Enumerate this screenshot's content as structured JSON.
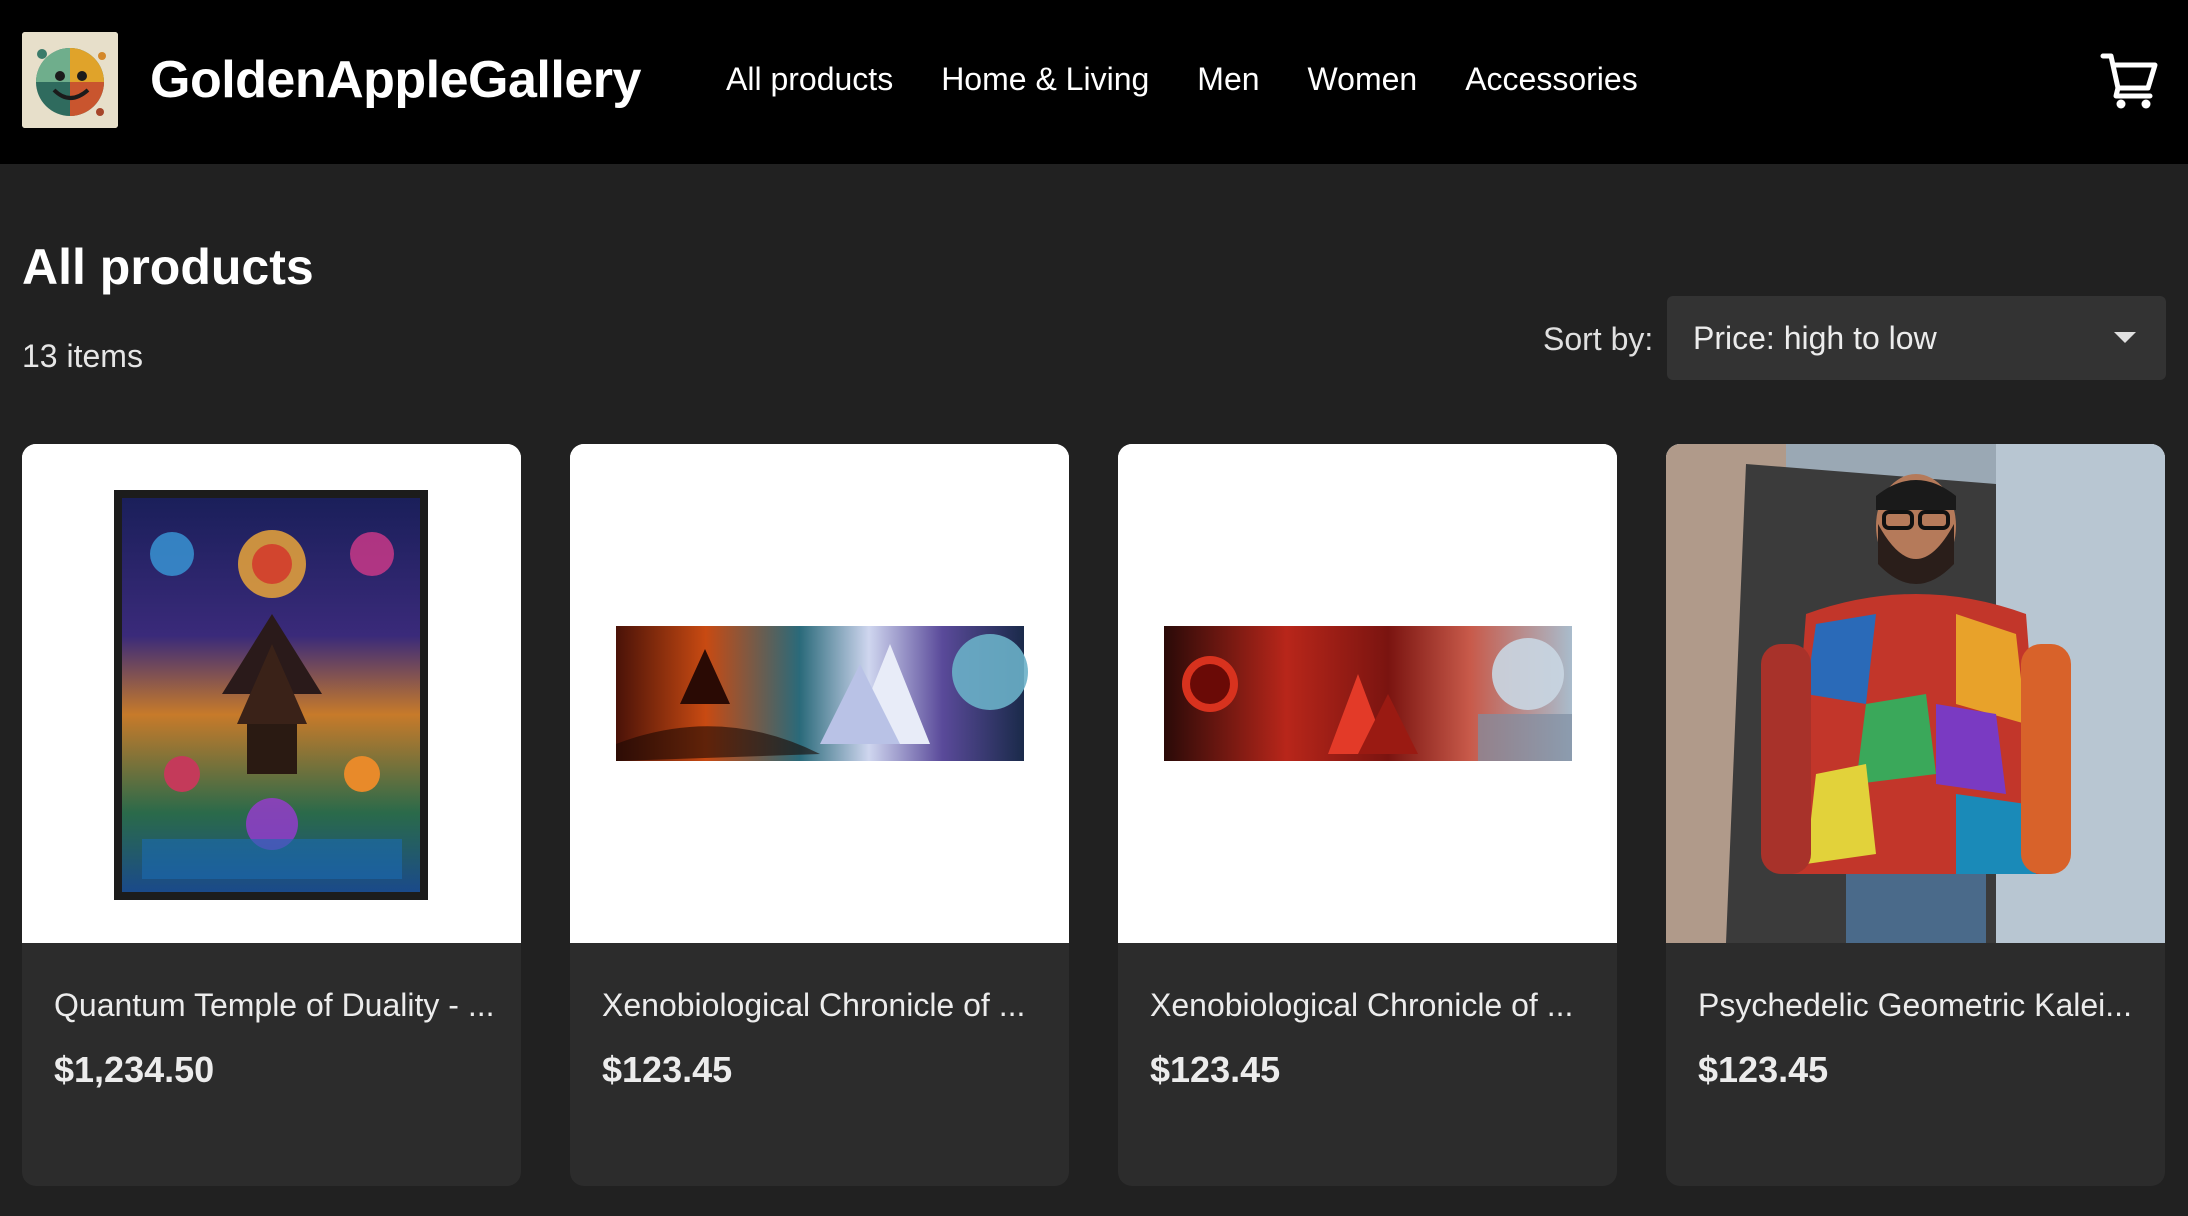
{
  "header": {
    "brand": "GoldenAppleGallery",
    "nav": [
      "All products",
      "Home & Living",
      "Men",
      "Women",
      "Accessories"
    ],
    "cart_icon": "cart-icon",
    "logo_icon": "smiling-face-logo"
  },
  "main": {
    "title": "All products",
    "count": "13 items",
    "sort": {
      "label": "Sort by:",
      "value": "Price: high to low"
    },
    "products": [
      {
        "name": "Quantum Temple of Duality - ...",
        "price": "$1,234.50",
        "image": "framed-psychedelic-temple-canvas"
      },
      {
        "name": "Xenobiological Chronicle of ...",
        "price": "$123.45",
        "image": "panoramic-fire-ice-landscape-print"
      },
      {
        "name": "Xenobiological Chronicle of ...",
        "price": "$123.45",
        "image": "panoramic-red-alien-landscape-print"
      },
      {
        "name": "Psychedelic Geometric Kalei...",
        "price": "$123.45",
        "image": "man-wearing-geometric-hoodie"
      }
    ]
  },
  "colors": {
    "header_bg": "#000000",
    "page_bg": "#212121",
    "card_bg": "#2c2c2c",
    "select_bg": "#333333"
  }
}
